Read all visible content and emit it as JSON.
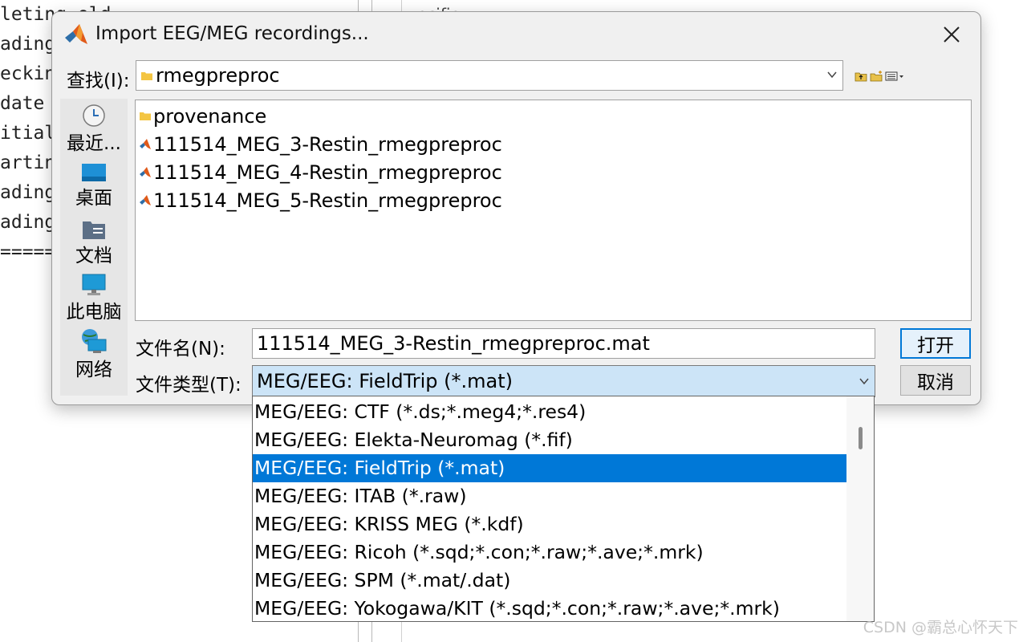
{
  "console": {
    "lines": [
      "leting old",
      "ading",
      "ecking",
      "date",
      "itial",
      "arting",
      "ading",
      "ading",
      "======"
    ],
    "right_fragment": "ecifie"
  },
  "dialog": {
    "title": "Import EEG/MEG recordings...",
    "look_in_label": "查找(I):",
    "look_in_value": "rmegpreproc",
    "places": [
      "最近...",
      "桌面",
      "文档",
      "此电脑",
      "网络"
    ],
    "files": [
      {
        "name": "provenance",
        "icon": "folder-icon"
      },
      {
        "name": "111514_MEG_3-Restin_rmegpreproc",
        "icon": "matlab-file-icon"
      },
      {
        "name": "111514_MEG_4-Restin_rmegpreproc",
        "icon": "matlab-file-icon"
      },
      {
        "name": "111514_MEG_5-Restin_rmegpreproc",
        "icon": "matlab-file-icon"
      }
    ],
    "file_name_label": "文件名(N):",
    "file_name_value": "111514_MEG_3-Restin_rmegpreproc.mat",
    "file_type_label": "文件类型(T):",
    "file_type_value": "MEG/EEG: FieldTrip (*.mat)",
    "open_button": "打开",
    "cancel_button": "取消"
  },
  "dropdown": {
    "options": [
      "MEG/EEG: CTF (*.ds;*.meg4;*.res4)",
      "MEG/EEG: Elekta-Neuromag (*.fif)",
      "MEG/EEG: FieldTrip (*.mat)",
      "MEG/EEG: ITAB (*.raw)",
      "MEG/EEG: KRISS MEG (*.kdf)",
      "MEG/EEG: Ricoh (*.sqd;*.con;*.raw;*.ave;*.mrk)",
      "MEG/EEG: SPM (*.mat/.dat)",
      "MEG/EEG: Yokogawa/KIT (*.sqd;*.con;*.raw;*.ave;*.mrk)"
    ],
    "selected_index": 2
  },
  "watermark": "CSDN @霸总心怀天下",
  "colors": {
    "selection": "#0078d7",
    "select_bg": "#cce4f7",
    "dialog_bg": "#f0f0f0"
  }
}
